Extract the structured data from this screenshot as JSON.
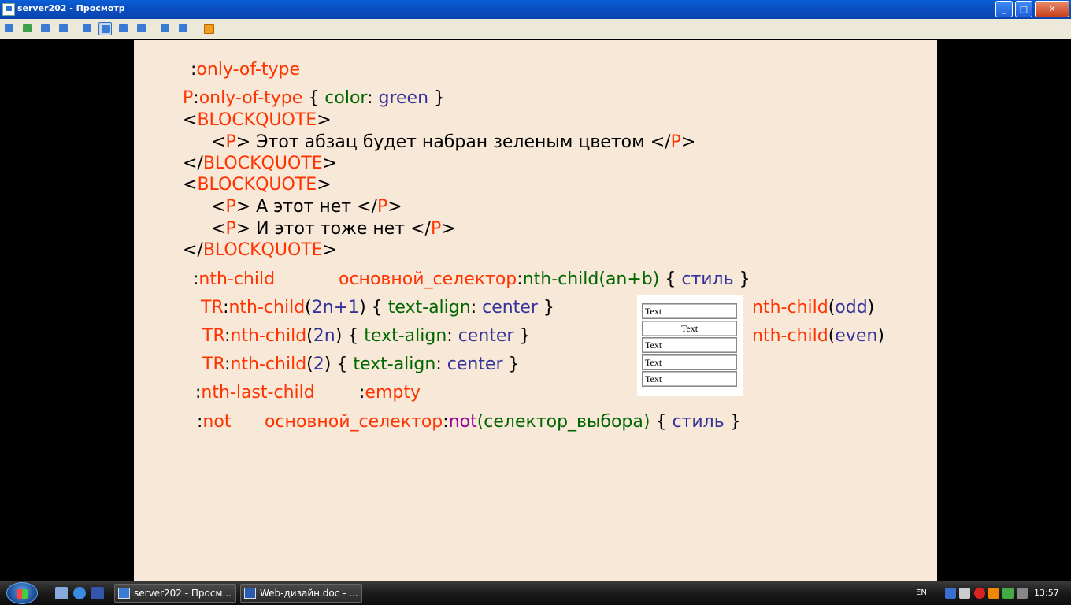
{
  "window": {
    "title": "server202 - Просмотр"
  },
  "toolbar": {
    "icons": [
      "screen-icon",
      "transfer-icon",
      "phone-icon",
      "chat-icon",
      "window-icon",
      "fit-icon",
      "fullscreen-icon",
      "zoom-icon",
      "copy-icon",
      "tools-icon",
      "close-connection-icon"
    ]
  },
  "slide": {
    "only_of_type": {
      "marker": ":",
      "name": "only-of-type"
    },
    "code": {
      "l1": {
        "p": "P",
        "colon": ":",
        "sel": "only-of-type",
        "ob": " { ",
        "prop": "color",
        "c2": ": ",
        "val": "green",
        "cb": " }"
      },
      "bq_open": "<",
      "bq_name": "BLOCKQUOTE",
      "bq_close": ">",
      "bq_end_open": "</",
      "p_open": "<",
      "p_tag": "P",
      "p_gt": ">",
      "p_end_open": " </",
      "text1": " Этот абзац будет набран зеленым цветом",
      "text2": " А этот нет",
      "text3": " И этот тоже нет"
    },
    "nth_child": {
      "marker": ":",
      "name": "nth-child",
      "syntax": {
        "base": "основной_селектор",
        "colon": ":",
        "fn": "nth-child(an+b)",
        "ob": " { ",
        "style": "стиль",
        "cb": " }"
      }
    },
    "examples": [
      {
        "tag": "TR",
        "colon": ":",
        "fn": "nth-child",
        "po": "(",
        "arg": "2n+1",
        "pc": ")",
        "ob": " { ",
        "prop": "text-align",
        "c2": ": ",
        "val": "center",
        "cb": " }"
      },
      {
        "tag": "TR",
        "colon": ":",
        "fn": "nth-child",
        "po": "(",
        "arg": "2n",
        "pc": ")",
        "ob": " { ",
        "prop": "text-align",
        "c2": ": ",
        "val": "center",
        "cb": " }"
      },
      {
        "tag": "TR",
        "colon": ":",
        "fn": "nth-child",
        "po": "(",
        "arg": "2",
        "pc": ")",
        "ob": " { ",
        "prop": "text-align",
        "c2": ": ",
        "val": "center",
        "cb": " }"
      }
    ],
    "odd": {
      "fn": "nth-child",
      "po": "(",
      "arg": "odd",
      "pc": ")"
    },
    "even": {
      "fn": "nth-child",
      "po": "(",
      "arg": "even",
      "pc": ")"
    },
    "nth_last_child": {
      "marker": ":",
      "name": "nth-last-child"
    },
    "empty": {
      "marker": ":",
      "name": "empty"
    },
    "not": {
      "marker": ":",
      "name": "not",
      "syntax": {
        "base": "основной_селектор",
        "colon": ":",
        "fn": "not",
        "args": "(селектор_выбора)",
        "ob": " { ",
        "style": "стиль",
        "cb": " }"
      }
    },
    "demo_table": {
      "rows": [
        "Text",
        "Text",
        "Text",
        "Text",
        "Text"
      ]
    }
  },
  "taskbar": {
    "tasks": [
      "server202 - Просм...",
      "Web-дизайн.doc - ..."
    ],
    "lang": "EN",
    "clock": "13:57"
  },
  "colors": {
    "red": "#ff3300",
    "green": "#006600",
    "blue": "#333399",
    "slide_bg": "#f8e8d8"
  }
}
